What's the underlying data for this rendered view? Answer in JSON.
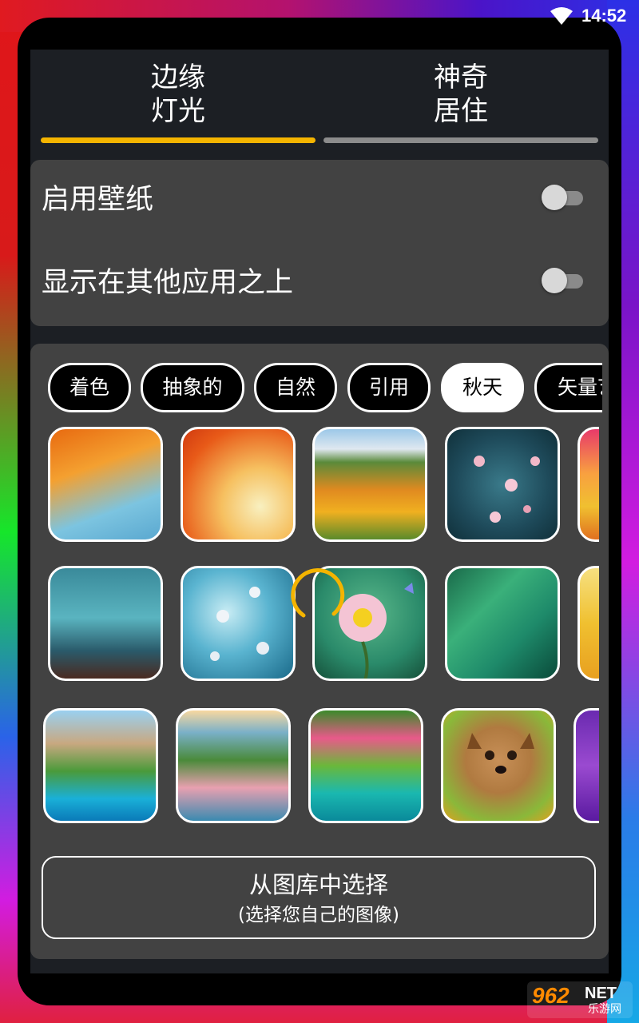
{
  "status_bar": {
    "time": "14:52",
    "wifi_icon": "wifi-icon"
  },
  "tabs": [
    {
      "line1": "边缘",
      "line2": "灯光",
      "selected": true,
      "indicator_color": "#f4b400"
    },
    {
      "line1": "神奇",
      "line2": "居住",
      "selected": false,
      "indicator_color": "#8c8c8c"
    }
  ],
  "settings": [
    {
      "label": "启用壁纸",
      "enabled": false
    },
    {
      "label": "显示在其他应用之上",
      "enabled": false
    }
  ],
  "categories": [
    {
      "label": "着色",
      "selected": false
    },
    {
      "label": "抽象的",
      "selected": false
    },
    {
      "label": "自然",
      "selected": false
    },
    {
      "label": "引用",
      "selected": false
    },
    {
      "label": "秋天",
      "selected": true
    },
    {
      "label": "矢量艺",
      "selected": false
    }
  ],
  "wallpapers": [
    {
      "name": "autumn-maple-leaves"
    },
    {
      "name": "orange-maple-leaves"
    },
    {
      "name": "autumn-mountain-forest"
    },
    {
      "name": "plum-blossom-branch"
    },
    {
      "name": "autumn-sunset"
    },
    {
      "name": "misty-autumn-forest"
    },
    {
      "name": "blue-blossom-branch"
    },
    {
      "name": "pink-flower-butterfly"
    },
    {
      "name": "green-leaves"
    },
    {
      "name": "golden-forest"
    },
    {
      "name": "waterfall-mountain"
    },
    {
      "name": "mountain-sunrise-blossom"
    },
    {
      "name": "flower-waterfall"
    },
    {
      "name": "yorkshire-terrier"
    },
    {
      "name": "purple-flower"
    }
  ],
  "gallery_button": {
    "title": "从图库中选择",
    "subtitle": "(选择您自己的图像)"
  },
  "watermark": {
    "number": "962",
    "suffix": "NET",
    "site": "乐游网"
  },
  "colors": {
    "accent": "#f4b400",
    "card": "#424242",
    "screen": "#1c1f24"
  }
}
